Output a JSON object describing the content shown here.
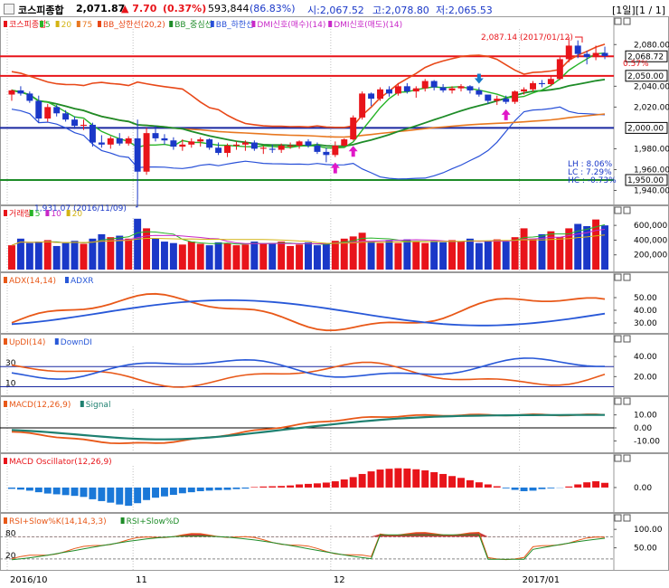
{
  "header": {
    "name": "코스피종합",
    "price": "2,071.87",
    "change": "▲ 7.70",
    "change_pct": "(0.37%)",
    "volume": "593,844",
    "vol_ratio": "(86.83%)",
    "open": "시:2,067.52",
    "high": "고:2,078.80",
    "low": "저:2,065.53",
    "period": "[1일][1 / 1]"
  },
  "colors": {
    "up": "#e8141a",
    "down": "#1a38c8",
    "ma5": "#28b428",
    "ma20": "#d4b414",
    "ma75": "#e87820",
    "bb_upper": "#e84818",
    "bb_mid": "#1e8c28",
    "bb_lower": "#2850d8",
    "hline_red": "#e8141a",
    "hline_blue": "#1a28a0",
    "hline_green": "#1e8c28"
  },
  "chart_data": [
    {
      "type": "candlestick",
      "panel": "price",
      "legend": [
        "코스피종합",
        "5",
        "20",
        "75",
        "BB_상한선(20,2)",
        "BB_중심선",
        "BB_하한선",
        "DMI신호(매수)(14)",
        "DMI신호(매도)(14)"
      ],
      "ylim": [
        1930,
        2095
      ],
      "yticks": [
        2080,
        2040,
        2020,
        1980,
        1960,
        1940
      ],
      "ytick_labels": [
        "2,080.00",
        "2,040.00",
        "2,020.00",
        "1,980.00",
        "1,960.00",
        "1,940.00"
      ],
      "hlines": [
        {
          "value": 2068.72,
          "label": "2,068.72",
          "color": "red"
        },
        {
          "value": 2050.0,
          "label": "2,050.00",
          "color": "red"
        },
        {
          "value": 2000.0,
          "label": "2,000.00",
          "color": "blue"
        },
        {
          "value": 1950.0,
          "label": "1,950.00",
          "color": "green"
        }
      ],
      "pct_label": "0.57%",
      "annotations": [
        {
          "text": "2,087.14 (2017/01/12)",
          "value": 2087.14
        },
        {
          "text": "1,931.07 (2016/11/09)",
          "value": 1931.07
        }
      ],
      "stats": [
        "LH : 8.06%",
        "LC : 7.29%",
        "HC : -0.73%"
      ],
      "ohlc": [
        [
          2032,
          2037,
          2026,
          2036
        ],
        [
          2036,
          2040,
          2031,
          2033
        ],
        [
          2033,
          2035,
          2024,
          2026
        ],
        [
          2026,
          2031,
          2005,
          2009
        ],
        [
          2009,
          2023,
          2006,
          2020
        ],
        [
          2020,
          2022,
          2011,
          2014
        ],
        [
          2014,
          2017,
          2006,
          2008
        ],
        [
          2008,
          2011,
          1999,
          2002
        ],
        [
          2002,
          2008,
          1998,
          2003
        ],
        [
          2003,
          2005,
          1982,
          1986
        ],
        [
          1986,
          1993,
          1981,
          1984
        ],
        [
          1984,
          1992,
          1980,
          1990
        ],
        [
          1990,
          1995,
          1983,
          1985
        ],
        [
          1985,
          1992,
          1983,
          1990
        ],
        [
          1990,
          2008,
          1931,
          1958
        ],
        [
          1958,
          2000,
          1955,
          1995
        ],
        [
          1995,
          2002,
          1987,
          1990
        ],
        [
          1990,
          1994,
          1984,
          1988
        ],
        [
          1988,
          1991,
          1979,
          1982
        ],
        [
          1982,
          1989,
          1978,
          1984
        ],
        [
          1984,
          1990,
          1981,
          1987
        ],
        [
          1987,
          1991,
          1982,
          1989
        ],
        [
          1989,
          1990,
          1979,
          1981
        ],
        [
          1981,
          1986,
          1974,
          1976
        ],
        [
          1976,
          1985,
          1972,
          1983
        ],
        [
          1983,
          1987,
          1979,
          1984
        ],
        [
          1984,
          1988,
          1978,
          1986
        ],
        [
          1986,
          1988,
          1978,
          1980
        ],
        [
          1980,
          1983,
          1975,
          1981
        ],
        [
          1980,
          1984,
          1976,
          1979
        ],
        [
          1979,
          1985,
          1976,
          1983
        ],
        [
          1983,
          1986,
          1980,
          1983
        ],
        [
          1983,
          1988,
          1980,
          1987
        ],
        [
          1987,
          1989,
          1981,
          1983
        ],
        [
          1983,
          1986,
          1975,
          1977
        ],
        [
          1977,
          1981,
          1967,
          1974
        ],
        [
          1974,
          1987,
          1972,
          1983
        ],
        [
          1983,
          1990,
          1982,
          1989
        ],
        [
          1989,
          2012,
          1988,
          2010
        ],
        [
          2010,
          2035,
          2008,
          2033
        ],
        [
          2033,
          2034,
          2021,
          2028
        ],
        [
          2028,
          2039,
          2026,
          2037
        ],
        [
          2037,
          2040,
          2030,
          2033
        ],
        [
          2033,
          2043,
          2031,
          2040
        ],
        [
          2040,
          2043,
          2033,
          2035
        ],
        [
          2035,
          2040,
          2029,
          2038
        ],
        [
          2038,
          2047,
          2035,
          2045
        ],
        [
          2045,
          2046,
          2036,
          2039
        ],
        [
          2039,
          2042,
          2034,
          2036
        ],
        [
          2036,
          2040,
          2033,
          2038
        ],
        [
          2038,
          2042,
          2035,
          2040
        ],
        [
          2040,
          2041,
          2033,
          2036
        ],
        [
          2036,
          2039,
          2030,
          2032
        ],
        [
          2032,
          2030,
          2023,
          2026
        ],
        [
          2026,
          2031,
          2022,
          2028
        ],
        [
          2028,
          2031,
          2023,
          2025
        ],
        [
          2025,
          2036,
          2023,
          2035
        ],
        [
          2035,
          2039,
          2032,
          2037
        ],
        [
          2037,
          2045,
          2035,
          2043
        ],
        [
          2043,
          2046,
          2039,
          2042
        ],
        [
          2042,
          2050,
          2040,
          2047
        ],
        [
          2047,
          2068,
          2046,
          2066
        ],
        [
          2066,
          2087,
          2063,
          2079
        ],
        [
          2079,
          2084,
          2067,
          2071
        ],
        [
          2071,
          2074,
          2061,
          2068
        ],
        [
          2068,
          2079,
          2065,
          2072
        ],
        [
          2072,
          2078,
          2066,
          2069
        ]
      ]
    },
    {
      "type": "bar",
      "panel": "volume",
      "legend": [
        "거래량",
        "5",
        "10",
        "20"
      ],
      "ylim": [
        0,
        700000
      ],
      "ytick_labels": [
        "600,000",
        "400,000",
        "200,000"
      ],
      "values": [
        330,
        420,
        360,
        380,
        400,
        320,
        360,
        390,
        350,
        420,
        480,
        440,
        460,
        420,
        690,
        560,
        420,
        380,
        360,
        340,
        380,
        350,
        330,
        370,
        360,
        330,
        340,
        380,
        350,
        360,
        380,
        320,
        340,
        370,
        330,
        360,
        390,
        420,
        450,
        500,
        380,
        360,
        400,
        360,
        410,
        380,
        360,
        390,
        370,
        400,
        380,
        420,
        360,
        390,
        410,
        380,
        440,
        560,
        420,
        480,
        520,
        440,
        560,
        620,
        590,
        680,
        600
      ]
    },
    {
      "type": "line",
      "panel": "ADX",
      "legend": [
        "ADX(14,14)",
        "ADXR"
      ],
      "ylim": [
        25,
        60
      ],
      "ytick_labels": [
        "50.00",
        "40.00",
        "30.00"
      ]
    },
    {
      "type": "line",
      "panel": "DMI",
      "legend": [
        "UpDI(14)",
        "DownDI"
      ],
      "ylim": [
        5,
        50
      ],
      "ytick_labels": [
        "40.00",
        "20.00"
      ],
      "levels": [
        "30",
        "10"
      ]
    },
    {
      "type": "line",
      "panel": "MACD",
      "legend": [
        "MACD(12,26,9)",
        "Signal"
      ],
      "ylim": [
        -16,
        16
      ],
      "ytick_labels": [
        "10.00",
        "0.00",
        "-10.00"
      ]
    },
    {
      "type": "bar",
      "panel": "MACD Oscillator",
      "legend": [
        "MACD Oscillator(12,26,9)"
      ],
      "ylim": [
        -8,
        9
      ],
      "ytick_labels": [
        "0.00"
      ],
      "values": [
        -0.5,
        -0.8,
        -1.2,
        -1.8,
        -2.3,
        -2.6,
        -2.9,
        -3.2,
        -3.6,
        -4.5,
        -5.2,
        -5.8,
        -6.5,
        -7.0,
        -6.0,
        -4.8,
        -3.9,
        -3.4,
        -2.8,
        -2.2,
        -1.8,
        -1.4,
        -1.2,
        -1.0,
        -0.9,
        -0.6,
        -0.4,
        0.2,
        0.4,
        0.5,
        0.6,
        0.8,
        1.2,
        1.4,
        1.6,
        1.9,
        2.4,
        3.1,
        4.0,
        5.2,
        6.2,
        6.9,
        7.2,
        7.4,
        7.3,
        7.0,
        6.6,
        5.9,
        5.2,
        4.4,
        3.7,
        2.8,
        2.0,
        1.2,
        0.5,
        -0.3,
        -0.9,
        -1.4,
        -1.2,
        -0.6,
        -0.3,
        -0.1,
        0.4,
        1.2,
        2.0,
        2.4,
        1.8
      ]
    },
    {
      "type": "line",
      "panel": "RSI",
      "legend": [
        "RSI+Slow%K(14,14,3,3)",
        "RSI+Slow%D"
      ],
      "ylim": [
        0,
        120
      ],
      "ytick_labels": [
        "100.00",
        "50.00"
      ],
      "levels": [
        "80",
        "20"
      ]
    }
  ],
  "x_axis": {
    "labels": [
      "2016/10",
      "11",
      "12",
      "2017/01"
    ]
  }
}
